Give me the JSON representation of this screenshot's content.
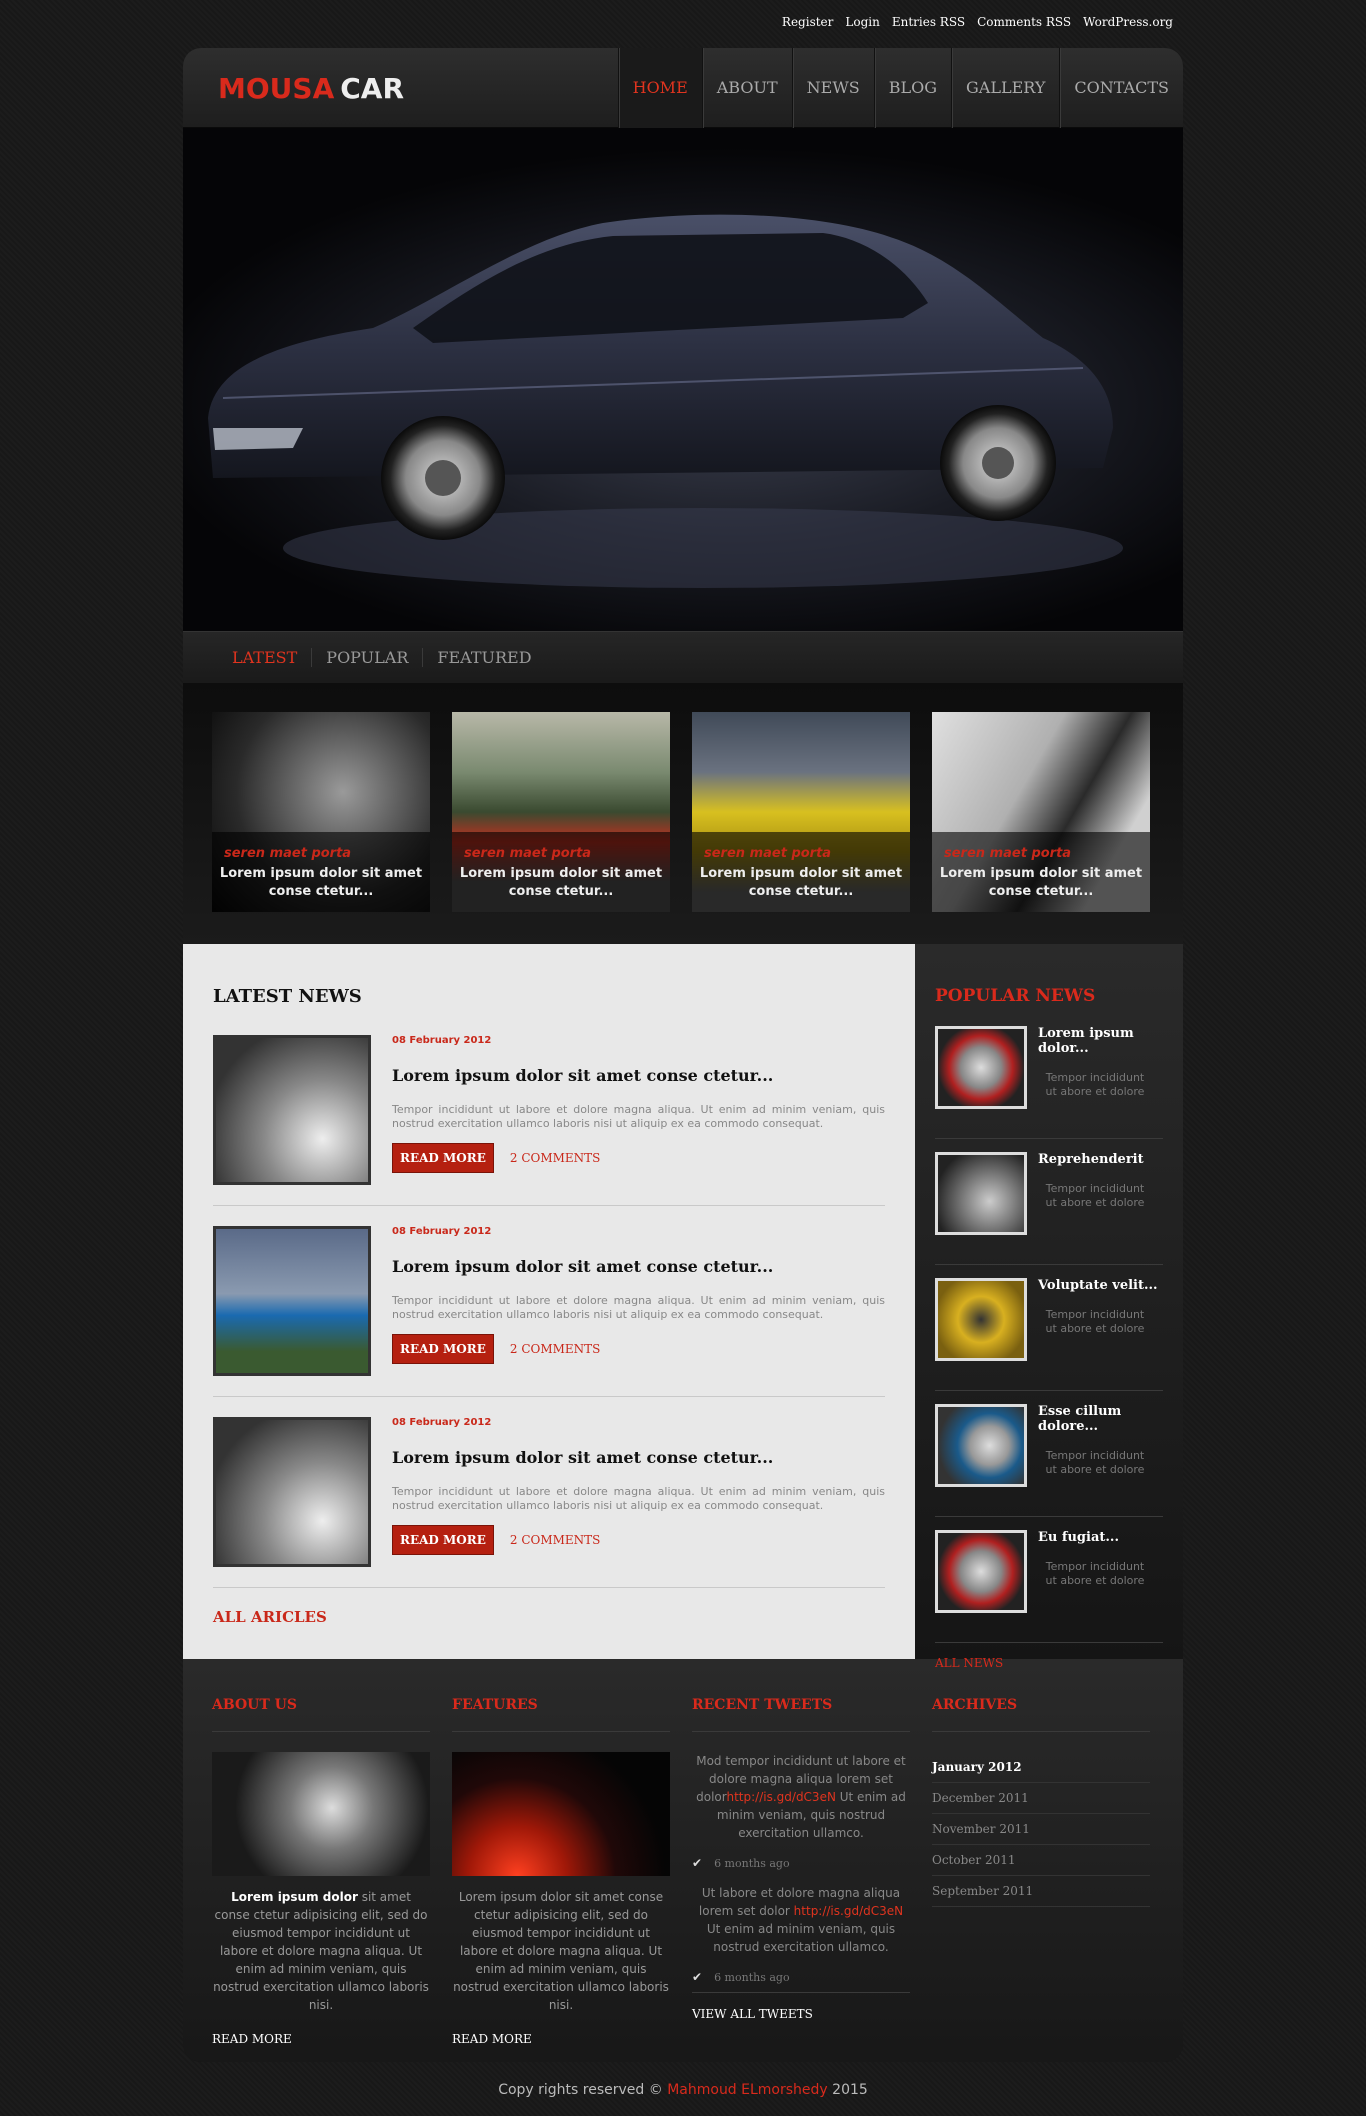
{
  "top_links": [
    "Register",
    "Login",
    "Entries RSS",
    "Comments RSS",
    "WordPress.org"
  ],
  "logo": {
    "part1": "MOUSA",
    "part2": "CAR"
  },
  "nav": [
    "HOME",
    "ABOUT",
    "NEWS",
    "BLOG",
    "GALLERY",
    "CONTACTS"
  ],
  "tabs": [
    "LATEST",
    "POPULAR",
    "FEATURED"
  ],
  "thumbs": [
    {
      "tag": "seren maet porta",
      "caption1": "Lorem ipsum dolor sit amet",
      "caption2": "conse ctetur..."
    },
    {
      "tag": "seren maet porta",
      "caption1": "Lorem ipsum dolor sit amet",
      "caption2": "conse ctetur..."
    },
    {
      "tag": "seren maet porta",
      "caption1": "Lorem ipsum dolor sit amet",
      "caption2": "conse ctetur..."
    },
    {
      "tag": "seren maet porta",
      "caption1": "Lorem ipsum dolor sit amet",
      "caption2": "conse ctetur..."
    }
  ],
  "latest_news": {
    "title": "LATEST NEWS",
    "articles": [
      {
        "date": "08 February 2012",
        "title": "Lorem ipsum dolor sit amet conse ctetur...",
        "desc": "Tempor incididunt ut labore et dolore magna aliqua. Ut enim ad minim veniam, quis nostrud exercitation ullamco laboris nisi ut aliquip ex ea commodo consequat.",
        "button": "READ MORE",
        "comments": "2 COMMENTS"
      },
      {
        "date": "08 February 2012",
        "title": "Lorem ipsum dolor sit amet conse ctetur...",
        "desc": "Tempor incididunt ut labore et dolore magna aliqua. Ut enim ad minim veniam, quis nostrud exercitation ullamco laboris nisi ut aliquip ex ea commodo consequat.",
        "button": "READ MORE",
        "comments": "2 COMMENTS"
      },
      {
        "date": "08 February 2012",
        "title": "Lorem ipsum dolor sit amet conse ctetur...",
        "desc": "Tempor incididunt ut labore et dolore magna aliqua. Ut enim ad minim veniam, quis nostrud exercitation ullamco laboris nisi ut aliquip ex ea commodo consequat.",
        "button": "READ MORE",
        "comments": "2 COMMENTS"
      }
    ],
    "all_link": "ALL ARICLES"
  },
  "popular_news": {
    "title": "POPULAR NEWS",
    "items": [
      {
        "title": "Lorem ipsum dolor...",
        "sub": "Tempor incididunt ut abore et dolore"
      },
      {
        "title": "Reprehenderit",
        "sub": "Tempor incididunt ut abore et dolore"
      },
      {
        "title": "Voluptate velit...",
        "sub": "Tempor incididunt ut abore et dolore"
      },
      {
        "title": "Esse cillum dolore...",
        "sub": "Tempor incididunt ut abore et dolore"
      },
      {
        "title": "Eu fugiat...",
        "sub": "Tempor incididunt ut abore et dolore"
      }
    ],
    "all_link": "ALL NEWS"
  },
  "footer": {
    "about": {
      "title": "ABOUT US",
      "lead": "Lorem ipsum dolor",
      "text": " sit amet conse ctetur adipisicing elit, sed do eiusmod tempor incididunt ut labore et dolore magna aliqua. Ut enim ad minim veniam, quis nostrud exercitation ullamco laboris nisi.",
      "more": "READ MORE"
    },
    "features": {
      "title": "FEATURES",
      "text": "Lorem ipsum dolor sit amet conse ctetur adipisicing elit, sed do eiusmod tempor incididunt ut labore et dolore magna aliqua. Ut enim ad minim veniam, quis nostrud exercitation ullamco laboris nisi.",
      "more": "READ MORE"
    },
    "tweets": {
      "title": "RECENT TWEETS",
      "items": [
        {
          "pre": "Mod tempor incididunt ut labore et dolore magna aliqua lorem set dolor",
          "link": "http://is.gd/dC3eN",
          "post": " Ut enim ad minim veniam, quis nostrud exercitation ullamco.",
          "time": "6 months ago"
        },
        {
          "pre": "Ut labore et dolore magna aliqua lorem set dolor ",
          "link": "http://is.gd/dC3eN",
          "post": " Ut enim ad minim veniam, quis nostrud exercitation ullamco.",
          "time": "6 months ago"
        }
      ],
      "all_link": "VIEW ALL TWEETS"
    },
    "archives": {
      "title": "ARCHIVES",
      "items": [
        "January 2012",
        "December 2011",
        "November 2011",
        "October 2011",
        "September 2011"
      ]
    }
  },
  "copyright": {
    "pre": "Copy rights reserved © ",
    "name": "Mahmoud ELmorshedy",
    "year": "  2015"
  },
  "colors": {
    "accent": "#d92a1c",
    "page_bg": "#1a1a1a",
    "content_bg": "#e8e8e8"
  }
}
